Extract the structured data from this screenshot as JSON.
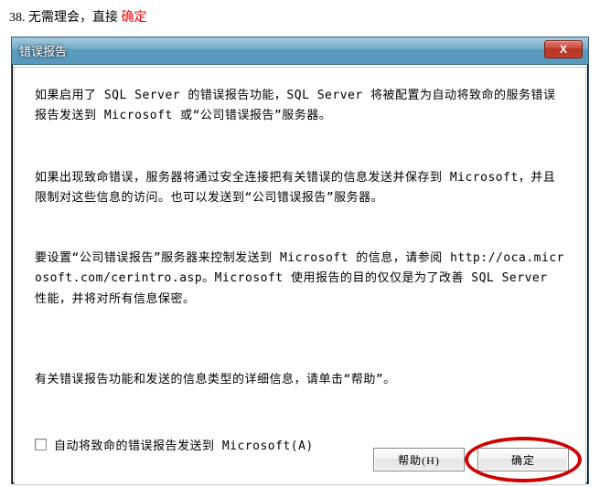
{
  "instruction": {
    "num": "38. ",
    "black_text": "无需理会，直接 ",
    "red_text": "确定"
  },
  "dialog": {
    "title": "错误报告",
    "close_icon": "X",
    "para1": "如果启用了 SQL Server 的错误报告功能，SQL Server 将被配置为自动将致命的服务错误报告发送到 Microsoft 或“公司错误报告”服务器。",
    "para2": "如果出现致命错误，服务器将通过安全连接把有关错误的信息发送并保存到 Microsoft，并且限制对这些信息的访问。也可以发送到“公司错误报告”服务器。",
    "para3": "要设置“公司错误报告”服务器来控制发送到 Microsoft 的信息，请参阅 http://oca.microsoft.com/cerintro.asp。Microsoft 使用报告的目的仅仅是为了改善 SQL Server 性能，并将对所有信息保密。",
    "para4": "有关错误报告功能和发送的信息类型的详细信息，请单击“帮助”。",
    "checkbox_label": "自动将致命的错误报告发送到 Microsoft(A)",
    "help_button": "帮助(H)",
    "ok_button": "确定"
  }
}
